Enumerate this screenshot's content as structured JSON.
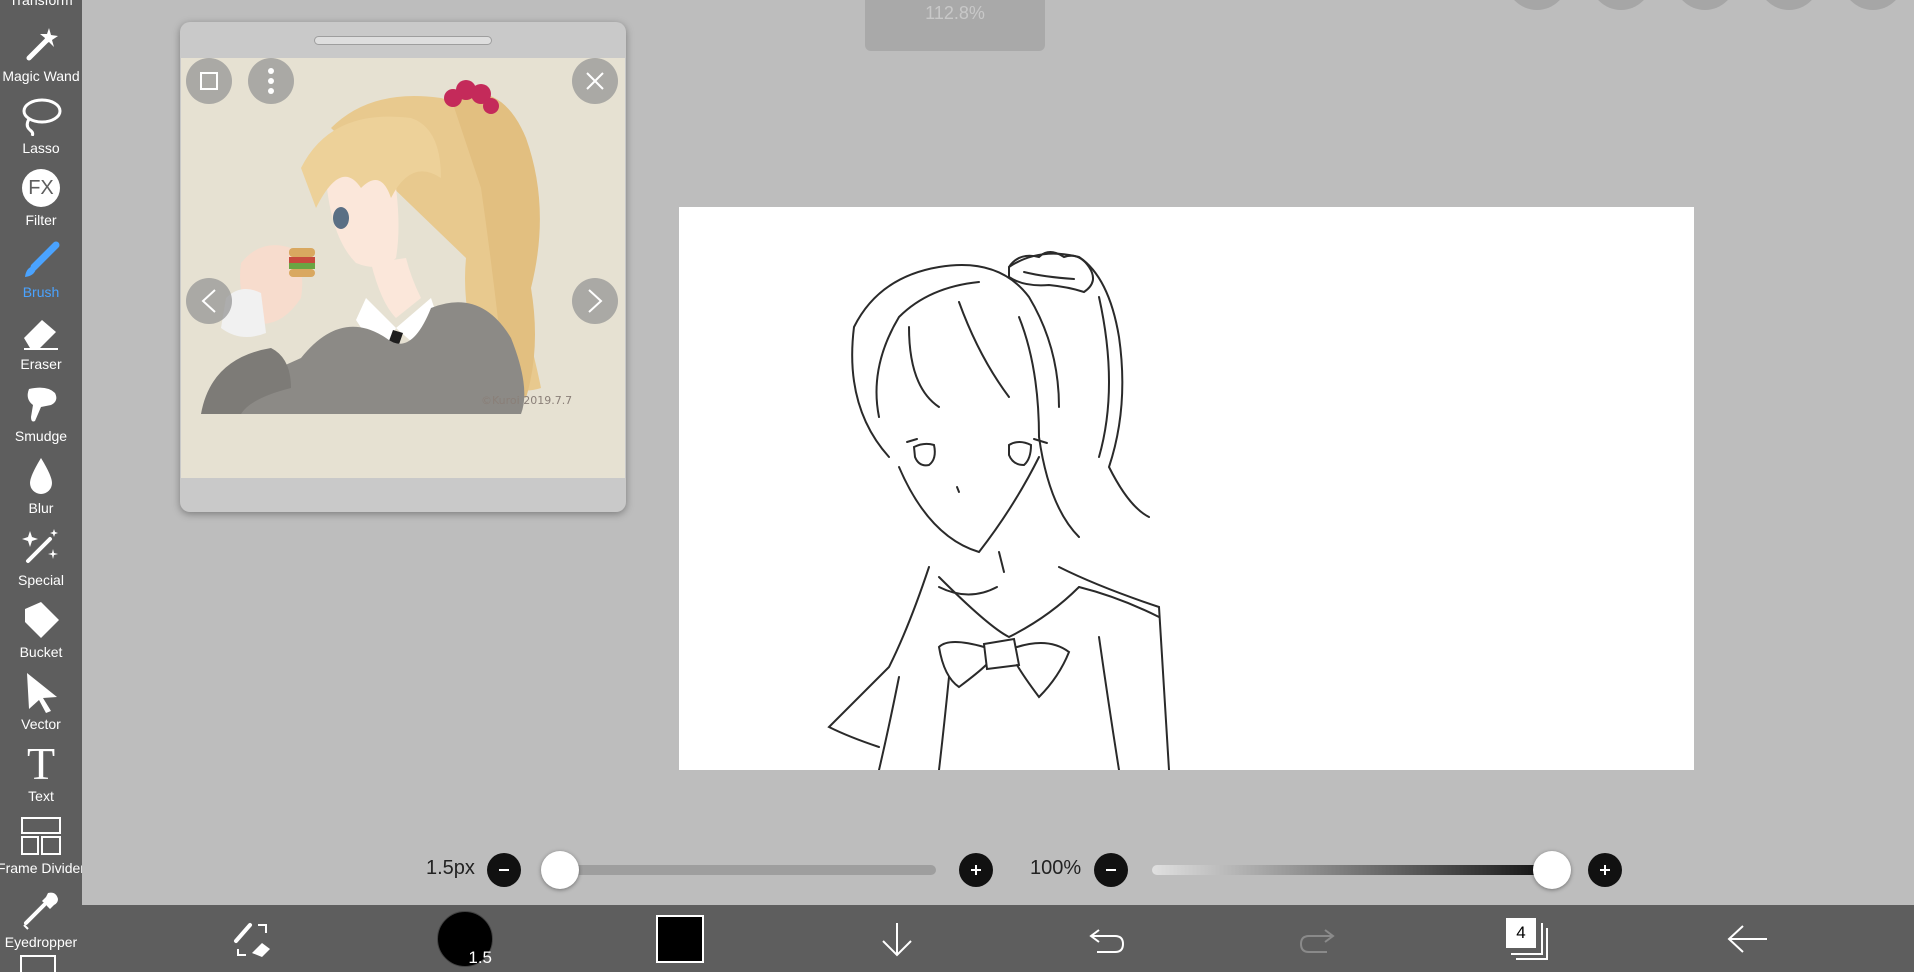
{
  "sidebar": {
    "partial_top_label": "Transform",
    "tools": [
      {
        "label": "Magic Wand",
        "icon": "magic-wand-icon"
      },
      {
        "label": "Lasso",
        "icon": "lasso-icon"
      },
      {
        "label": "Filter",
        "icon": "fx-icon",
        "icon_text": "FX"
      },
      {
        "label": "Brush",
        "icon": "brush-icon",
        "active": true
      },
      {
        "label": "Eraser",
        "icon": "eraser-icon"
      },
      {
        "label": "Smudge",
        "icon": "smudge-icon"
      },
      {
        "label": "Blur",
        "icon": "blur-drop-icon"
      },
      {
        "label": "Special",
        "icon": "special-sparkle-icon"
      },
      {
        "label": "Bucket",
        "icon": "bucket-icon"
      },
      {
        "label": "Vector",
        "icon": "vector-arrow-icon"
      },
      {
        "label": "Text",
        "icon": "text-icon",
        "icon_text": "T"
      },
      {
        "label": "Frame Divider",
        "icon": "frame-divider-icon"
      },
      {
        "label": "Eyedropper",
        "icon": "eyedropper-icon"
      }
    ],
    "active_color": "#4aa3ff"
  },
  "top": {
    "zoom_text": "112.8%"
  },
  "reference_window": {
    "signature": "©Kuroi 2019.7.7"
  },
  "sliders": {
    "brush_size": {
      "label": "1.5px",
      "fraction": 0.03
    },
    "opacity": {
      "label": "100%",
      "fraction": 1.0
    }
  },
  "bottombar": {
    "brush_size_badge": "1.5",
    "layer_count": "4",
    "current_color": "#000000"
  },
  "colors": {
    "background": "#bdbdbd",
    "sidebar": "#5e5e5e",
    "canvas": "#ffffff"
  }
}
